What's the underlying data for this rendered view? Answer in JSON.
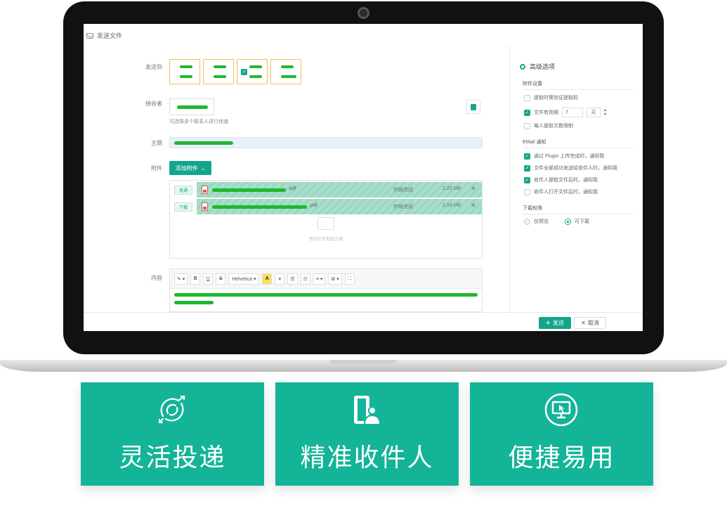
{
  "window": {
    "title": "发送文件"
  },
  "form": {
    "send_mode_label": "发送到",
    "recipients_label": "接收者",
    "recipients_hint": "可选择多个联系人进行快速",
    "subject_label": "主题",
    "attachments_label": "附件",
    "add_attachment_label": "添加附件",
    "attachments": [
      {
        "tag": "普通",
        "ext": ".pdf",
        "status": "传输完成",
        "size": "2.20 MB"
      },
      {
        "tag": "下载",
        "ext": ".pdf",
        "status": "传输完成",
        "size": "3.59 MB"
      }
    ],
    "drop_hint": "拖动文件到此区域",
    "body_label": "内容",
    "toolbar": {
      "pen": "✎ ▾",
      "bold": "B",
      "underline": "U",
      "strike": "S",
      "font": "Helvetica ▾",
      "color": "A",
      "color_arrow": "▾",
      "list_ul": "☰",
      "list_ol": "☷",
      "align": "≡ ▾",
      "table": "⊞ ▾",
      "fullscreen": "⛶"
    }
  },
  "footer": {
    "send_label": "发送",
    "cancel_label": "取消"
  },
  "side": {
    "title": "高级选项",
    "section_access": "附件设置",
    "opt_code": "提取时需验证提取码",
    "opt_expire": "文件有效期",
    "expire_days": "7",
    "expire_unit": "天",
    "opt_limit": "每人提取次数限制",
    "section_email": "EMail 通知",
    "opt_notify1": "通过 Plugin 上传完成时，通知我",
    "opt_notify2": "文件全部成功发送给收件人时，通知我",
    "opt_notify3": "收件人提取文件后时，通知我",
    "opt_notify4": "收件人打开文件后时，通知我",
    "section_perm": "下载权限",
    "perm_preview": "仅预览",
    "perm_download": "可下载"
  },
  "tiles": [
    {
      "label": "灵活投递",
      "icon": "flexible-delivery-icon"
    },
    {
      "label": "精准收件人",
      "icon": "precise-recipient-icon"
    },
    {
      "label": "便捷易用",
      "icon": "easy-to-use-icon"
    }
  ],
  "colors": {
    "accent": "#13b497",
    "teal_dark": "#13a58c",
    "redaction_green": "#1fb82f"
  }
}
